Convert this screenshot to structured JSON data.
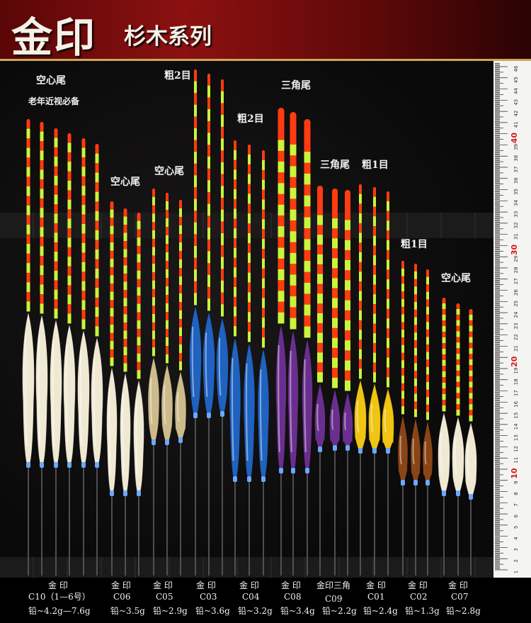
{
  "header": {
    "brand": "金印",
    "series": "杉木系列"
  },
  "annotations": [
    {
      "text": "空心尾"
    },
    {
      "text": "老年近视必备"
    },
    {
      "text": "空心尾"
    },
    {
      "text": "空心尾"
    },
    {
      "text": "粗2目"
    },
    {
      "text": "粗2目"
    },
    {
      "text": "三角尾"
    },
    {
      "text": "三角尾"
    },
    {
      "text": "粗1目"
    },
    {
      "text": "粗1目"
    },
    {
      "text": "空心尾"
    }
  ],
  "groups": [
    {
      "brand": "金 印",
      "model": "C10（1—6号）",
      "weight": "铅~4.2g—7.6g",
      "body_color": "#efe9d4",
      "floats": 6
    },
    {
      "brand": "金 印",
      "model": "C06",
      "weight": "铅~3.5g",
      "body_color": "#efe9d4",
      "floats": 3
    },
    {
      "brand": "金 印",
      "model": "C05",
      "weight": "铅~2.9g",
      "body_color": "#cdbb8c",
      "floats": 3
    },
    {
      "brand": "金 印",
      "model": "C03",
      "weight": "铅~3.6g",
      "body_color": "#1f62c0",
      "floats": 3
    },
    {
      "brand": "金 印",
      "model": "C04",
      "weight": "铅~3.2g",
      "body_color": "#1f62c0",
      "floats": 3
    },
    {
      "brand": "金 印",
      "model": "C08",
      "weight": "铅~3.4g",
      "body_color": "#6a2f8e",
      "floats": 3
    },
    {
      "brand": "金印三角",
      "model": "C09",
      "weight": "铅~2.2g",
      "body_color": "#6a2f8e",
      "floats": 3
    },
    {
      "brand": "金 印",
      "model": "C01",
      "weight": "铅~2.4g",
      "body_color": "#f0c412",
      "floats": 3
    },
    {
      "brand": "金 印",
      "model": "C02",
      "weight": "铅~1.3g",
      "body_color": "#8a4516",
      "floats": 3
    },
    {
      "brand": "金 印",
      "model": "C07",
      "weight": "铅~2.8g",
      "body_color": "#efe9d4",
      "floats": 3
    }
  ],
  "ruler": {
    "min_cm": 1,
    "max_cm": 46,
    "highlight_labels": [
      "10",
      "20",
      "30",
      "40"
    ]
  },
  "colors": {
    "tip_red": "#ff3b12",
    "tip_green": "#c9f53b",
    "stem": "#5f5f5f",
    "base_ring": "#6aa9ff"
  }
}
